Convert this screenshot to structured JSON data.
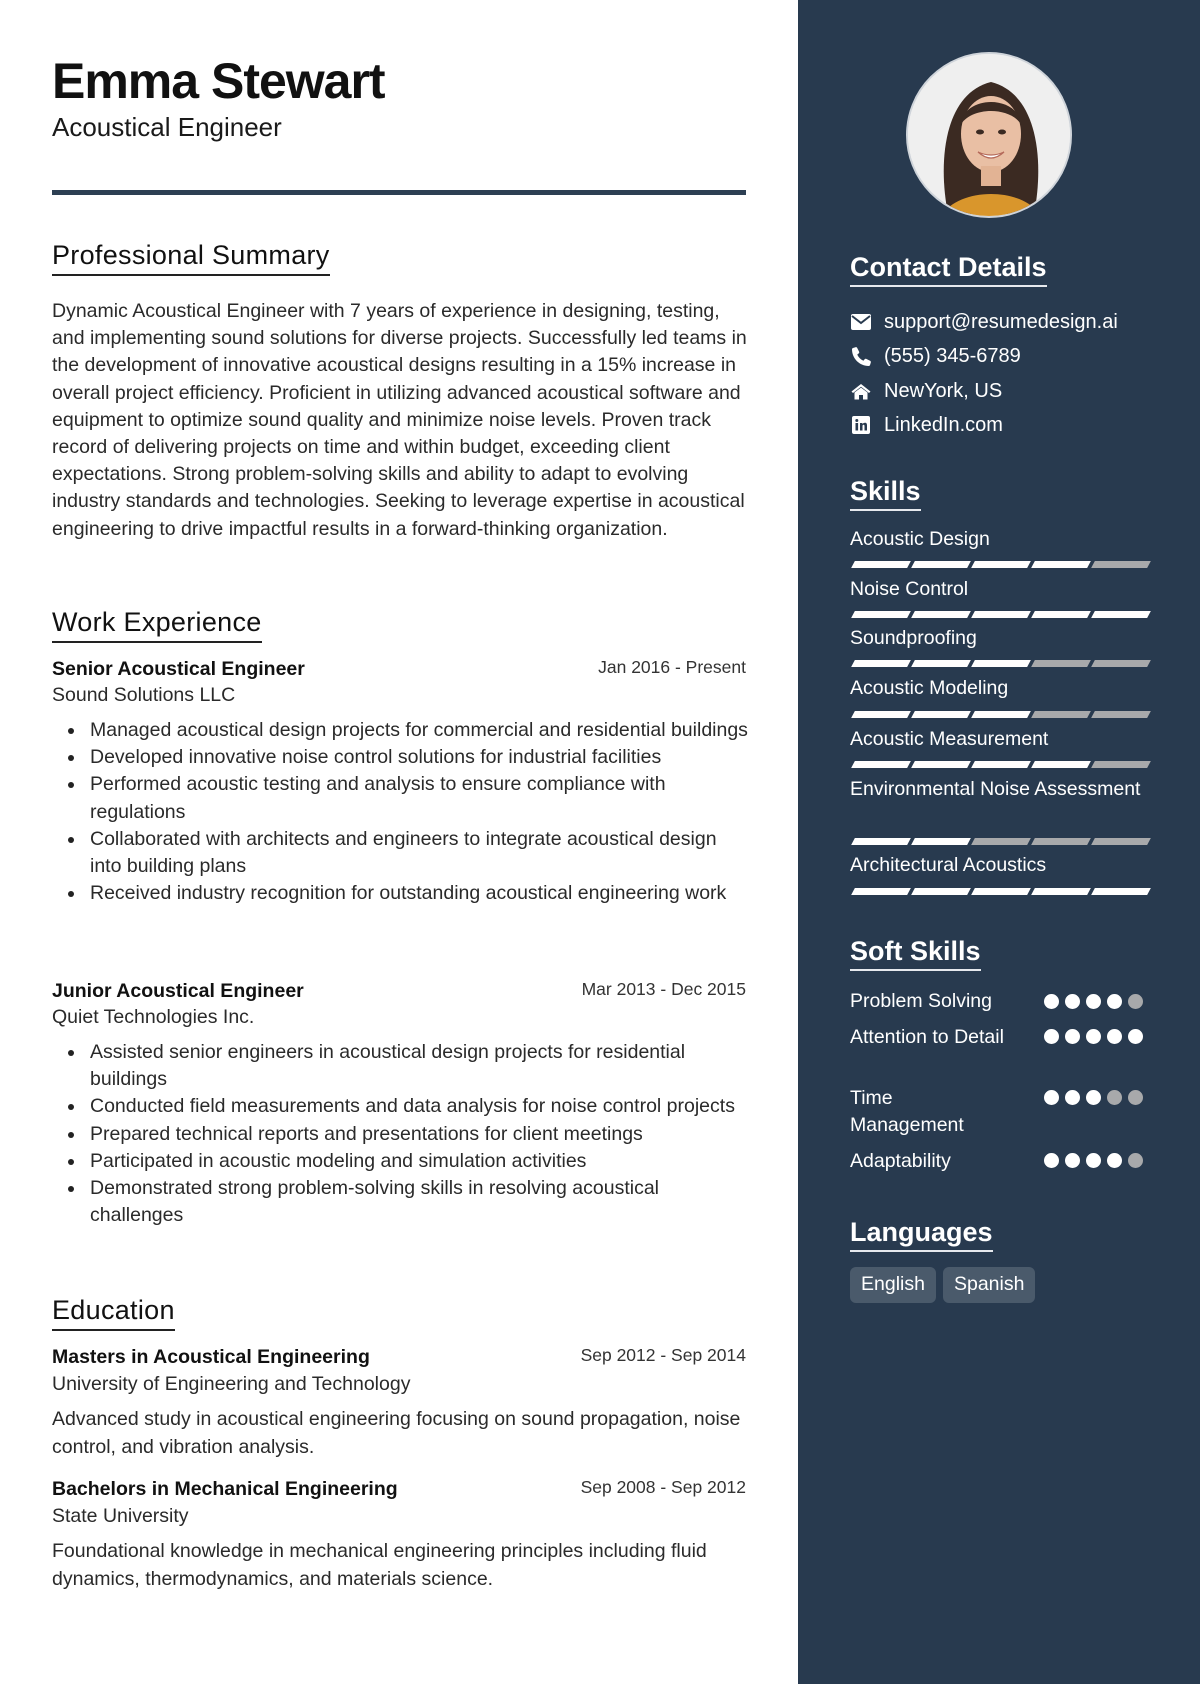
{
  "header": {
    "name": "Emma Stewart",
    "title": "Acoustical Engineer"
  },
  "summary": {
    "heading": "Professional Summary",
    "text": "Dynamic Acoustical Engineer with 7 years of experience in designing, testing, and implementing sound solutions for diverse projects. Successfully led teams in the development of innovative acoustical designs resulting in a 15% increase in overall project efficiency. Proficient in utilizing advanced acoustical software and equipment to optimize sound quality and minimize noise levels. Proven track record of delivering projects on time and within budget, exceeding client expectations. Strong problem-solving skills and ability to adapt to evolving industry standards and technologies. Seeking to leverage expertise in acoustical engineering to drive impactful results in a forward-thinking organization."
  },
  "experience": {
    "heading": "Work Experience",
    "jobs": [
      {
        "title": "Senior Acoustical Engineer",
        "dates": "Jan 2016 - Present",
        "company": "Sound Solutions LLC",
        "bullets": [
          "Managed acoustical design projects for commercial and residential buildings",
          "Developed innovative noise control solutions for industrial facilities",
          "Performed acoustic testing and analysis to ensure compliance with regulations",
          "Collaborated with architects and engineers to integrate acoustical design into building plans",
          "Received industry recognition for outstanding acoustical engineering work"
        ]
      },
      {
        "title": "Junior Acoustical Engineer",
        "dates": "Mar 2013 - Dec 2015",
        "company": "Quiet Technologies Inc.",
        "bullets": [
          "Assisted senior engineers in acoustical design projects for residential buildings",
          "Conducted field measurements and data analysis for noise control projects",
          "Prepared technical reports and presentations for client meetings",
          "Participated in acoustic modeling and simulation activities",
          "Demonstrated strong problem-solving skills in resolving acoustical challenges"
        ]
      }
    ]
  },
  "education": {
    "heading": "Education",
    "items": [
      {
        "degree": "Masters in Acoustical Engineering",
        "dates": "Sep 2012 - Sep 2014",
        "school": "University of Engineering and Technology",
        "description": "Advanced study in acoustical engineering focusing on sound propagation, noise control, and vibration analysis."
      },
      {
        "degree": "Bachelors in Mechanical Engineering",
        "dates": "Sep 2008 - Sep 2012",
        "school": "State University",
        "description": "Foundational knowledge in mechanical engineering principles including fluid dynamics, thermodynamics, and materials science."
      }
    ]
  },
  "sidebar": {
    "photo_alt": "Profile photo of Emma Stewart",
    "contact": {
      "heading": "Contact Details",
      "items": [
        {
          "icon": "envelope-icon",
          "text": "support@resumedesign.ai"
        },
        {
          "icon": "phone-icon",
          "text": "(555) 345-6789"
        },
        {
          "icon": "home-icon",
          "text": "NewYork, US"
        },
        {
          "icon": "linkedin-icon",
          "text": "LinkedIn.com"
        }
      ]
    },
    "skills": {
      "heading": "Skills",
      "max": 5,
      "items": [
        {
          "name": "Acoustic Design",
          "level": 4
        },
        {
          "name": "Noise Control",
          "level": 5
        },
        {
          "name": "Soundproofing",
          "level": 3
        },
        {
          "name": "Acoustic Modeling",
          "level": 3
        },
        {
          "name": "Acoustic Measurement",
          "level": 4
        },
        {
          "name": "Environmental Noise Assessment",
          "level": 2
        },
        {
          "name": "Architectural Acoustics",
          "level": 5
        }
      ]
    },
    "soft_skills": {
      "heading": "Soft Skills",
      "max": 5,
      "items": [
        {
          "name": "Problem Solving",
          "level": 4
        },
        {
          "name": "Attention to Detail",
          "level": 5
        },
        {
          "name": "Time Management",
          "level": 3
        },
        {
          "name": "Adaptability",
          "level": 4
        }
      ]
    },
    "languages": {
      "heading": "Languages",
      "items": [
        "English",
        "Spanish"
      ]
    }
  },
  "colors": {
    "sidebar_bg": "#283a4f",
    "accent_divider": "#2d3f53",
    "rating_on": "#ffffff",
    "rating_off": "#a8a9ab",
    "language_tag_bg": "#4a5a6b"
  }
}
